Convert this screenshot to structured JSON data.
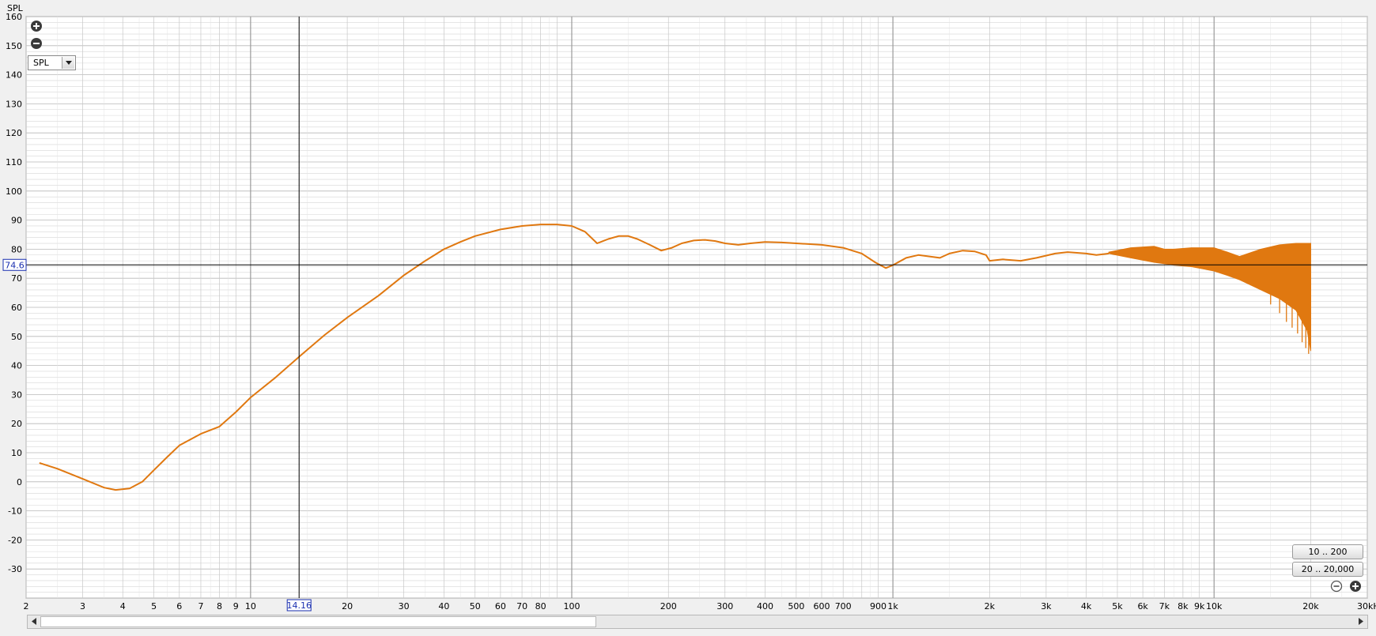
{
  "chart_data": {
    "type": "line",
    "title": "",
    "xlabel": "",
    "ylabel": "SPL",
    "xscale": "log",
    "xlim": [
      2,
      30000
    ],
    "ylim": [
      -40,
      160
    ],
    "x_unit_label": "30kHz",
    "x_ticks": [
      2,
      3,
      4,
      5,
      6,
      7,
      8,
      9,
      10,
      20,
      30,
      40,
      50,
      60,
      70,
      80,
      100,
      200,
      300,
      400,
      500,
      600,
      700,
      900,
      1000,
      2000,
      3000,
      4000,
      5000,
      6000,
      7000,
      8000,
      9000,
      10000,
      20000
    ],
    "x_tick_labels": [
      "2",
      "3",
      "4",
      "5",
      "6",
      "7",
      "8",
      "9",
      "10",
      "20",
      "30",
      "40",
      "50",
      "60",
      "70",
      "80",
      "100",
      "200",
      "300",
      "400",
      "500",
      "600",
      "700",
      "900",
      "1k",
      "2k",
      "3k",
      "4k",
      "5k",
      "6k",
      "7k",
      "8k",
      "9k",
      "10k",
      "20k"
    ],
    "y_ticks": [
      160,
      150,
      140,
      130,
      120,
      110,
      100,
      90,
      80,
      70,
      60,
      50,
      40,
      30,
      20,
      10,
      0,
      -10,
      -20,
      -30
    ],
    "y_tick_labels": [
      "160",
      "150",
      "140",
      "130",
      "120",
      "110",
      "100",
      "90",
      "80",
      "70",
      "60",
      "50",
      "40",
      "30",
      "20",
      "10",
      "0",
      "-10",
      "-20",
      "-30"
    ],
    "grid": true,
    "series": [
      {
        "color": "#e07810",
        "x": [
          2.2,
          2.5,
          3,
          3.5,
          3.8,
          4.2,
          4.6,
          5,
          5.5,
          6,
          7,
          8,
          9,
          10,
          12,
          14.16,
          17,
          20,
          25,
          30,
          35,
          40,
          45,
          50,
          60,
          70,
          80,
          90,
          100,
          110,
          120,
          130,
          140,
          150,
          160,
          175,
          190,
          205,
          220,
          240,
          260,
          280,
          300,
          330,
          360,
          400,
          450,
          500,
          600,
          700,
          800,
          880,
          950,
          1000,
          1100,
          1200,
          1300,
          1400,
          1500,
          1650,
          1800,
          1950,
          2000,
          2200,
          2500,
          2800,
          3200,
          3500,
          4000,
          4300,
          4700
        ],
        "y": [
          6.5,
          4.5,
          1,
          -2,
          -2.8,
          -2.3,
          0,
          4,
          8.5,
          12.5,
          16.5,
          19,
          24,
          29,
          36,
          43,
          50.5,
          56.5,
          64,
          71,
          76,
          80,
          82.5,
          84.5,
          86.8,
          88,
          88.5,
          88.5,
          88,
          86,
          82,
          83.5,
          84.5,
          84.5,
          83.5,
          81.5,
          79.5,
          80.5,
          82,
          83,
          83.2,
          82.8,
          82,
          81.5,
          82,
          82.5,
          82.3,
          82,
          81.5,
          80.5,
          78.5,
          75.5,
          73.5,
          74.5,
          77,
          78,
          77.5,
          77,
          78.5,
          79.5,
          79.2,
          78,
          76,
          76.5,
          76,
          77,
          78.5,
          79,
          78.5,
          78,
          78.5
        ]
      }
    ],
    "hf_envelope": {
      "x": [
        4700,
        5500,
        6500,
        7000,
        7500,
        8500,
        10000,
        11000,
        12000,
        14000,
        16000,
        18000,
        19500,
        20000
      ],
      "upper": [
        79,
        80.5,
        81,
        80,
        80,
        80.5,
        80.5,
        79,
        77.5,
        80,
        81.5,
        82,
        82,
        82
      ],
      "lower": [
        78.5,
        77,
        75.5,
        75,
        74.5,
        74,
        72.5,
        71,
        69.5,
        66,
        63,
        59,
        52,
        45
      ]
    },
    "cursor": {
      "x": 14.16,
      "y": 74.6,
      "x_label": "14.16",
      "y_label": "74.6"
    }
  },
  "controls": {
    "dropdown_value": "SPL",
    "zoom_in_icon": "plus-circle-icon",
    "zoom_out_icon": "minus-circle-icon",
    "range_buttons": [
      "10 .. 200",
      "20 .. 20,000"
    ]
  },
  "colors": {
    "curve": "#e07810",
    "grid_major": "#9a9a9a",
    "grid_minor": "#d6d6d6",
    "cursor_box": "#1a2fb0"
  }
}
